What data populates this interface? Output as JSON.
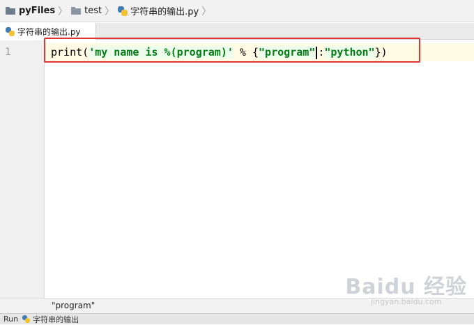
{
  "breadcrumb": [
    {
      "label": "pyFiles",
      "icon": "folder-icon"
    },
    {
      "label": "test",
      "icon": "folder-icon"
    },
    {
      "label": "字符串的输出.py",
      "icon": "python-file-icon"
    }
  ],
  "tabs": [
    {
      "label": "字符串的输出.py",
      "icon": "python-file-icon",
      "active": true
    }
  ],
  "editor": {
    "line_numbers": [
      "1"
    ],
    "code": {
      "func": "print",
      "open_paren": "(",
      "string1": "'my name is %(program)'",
      "percent": " % ",
      "open_brace": "{",
      "key": "\"program\"",
      "colon": ":",
      "value": "\"python\"",
      "close": "})"
    }
  },
  "status": {
    "text": "\"program\""
  },
  "run": {
    "label": "Run",
    "config": "字符串的输出"
  },
  "watermark": {
    "main": "Baidu 经验",
    "url": "jingyan.baidu.com"
  },
  "colors": {
    "string": "#067d17",
    "highlight_box": "#e03535",
    "current_line": "#fffae3"
  }
}
